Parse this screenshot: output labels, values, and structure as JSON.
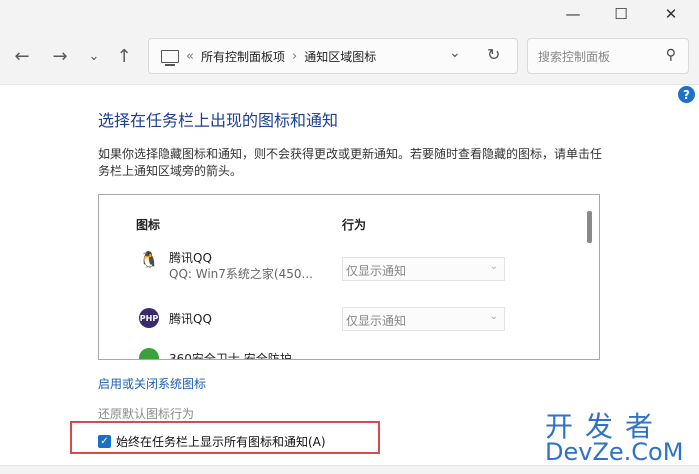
{
  "window": {
    "minimize_glyph": "—",
    "maximize_glyph": "☐",
    "close_glyph": "✕"
  },
  "nav": {
    "back_glyph": "←",
    "forward_glyph": "→",
    "recent_glyph": "⌄",
    "up_glyph": "↑"
  },
  "address": {
    "overflow": "«",
    "crumbs": [
      "所有控制面板项",
      "通知区域图标"
    ],
    "separator": "›",
    "dropdown_glyph": "⌄",
    "refresh_glyph": "↻"
  },
  "search": {
    "placeholder": "搜索控制面板",
    "icon_glyph": "⚲"
  },
  "help_glyph": "?",
  "page": {
    "heading": "选择在任务栏上出现的图标和通知",
    "description": "如果你选择隐藏图标和通知，则不会获得更改或更新通知。若要随时查看隐藏的图标，请单击任务栏上通知区域旁的箭头。"
  },
  "table": {
    "col_icon": "图标",
    "col_behavior": "行为",
    "rows": [
      {
        "name": "腾讯QQ",
        "sub": "QQ: Win7系统之家(450...",
        "behavior": "仅显示通知",
        "icon": "qq-penguin-icon",
        "color": "#111111"
      },
      {
        "name": "腾讯QQ",
        "sub": "",
        "behavior": "仅显示通知",
        "icon": "php-icon",
        "color": "#3b2a6b"
      },
      {
        "name": "360安全卫士 安全防护",
        "sub": "",
        "behavior": "",
        "icon": "360-shield-icon",
        "color": "#3aa13a"
      }
    ]
  },
  "links": {
    "toggle_system_icons": "启用或关闭系统图标",
    "restore_default": "还原默认图标行为"
  },
  "checkbox": {
    "label": "始终在任务栏上显示所有图标和通知(A)",
    "checked": true
  },
  "watermark": {
    "line1": "开发者",
    "line2": "DevZe.CoM"
  }
}
